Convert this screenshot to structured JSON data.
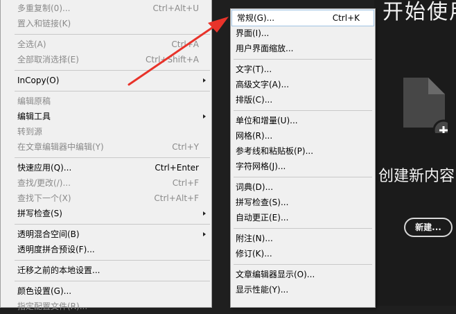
{
  "start": {
    "title": "开始使用",
    "create_text": "创建新内容",
    "new_button": "新建..."
  },
  "left_menu": {
    "items": [
      {
        "label": "多重复制(0)...",
        "shortcut": "Ctrl+Alt+U",
        "disabled": true
      },
      {
        "label": "置入和链接(K)",
        "shortcut": "",
        "disabled": true
      },
      {
        "label": "全选(A)",
        "shortcut": "Ctrl+A",
        "disabled": true
      },
      {
        "label": "全部取消选择(E)",
        "shortcut": "Ctrl+Shift+A",
        "disabled": true
      },
      {
        "label": "InCopy(O)",
        "shortcut": "",
        "disabled": false
      },
      {
        "label": "编辑原稿",
        "shortcut": "",
        "disabled": true
      },
      {
        "label": "编辑工具",
        "shortcut": "",
        "disabled": false
      },
      {
        "label": "转到源",
        "shortcut": "",
        "disabled": true
      },
      {
        "label": "在文章编辑器中编辑(Y)",
        "shortcut": "Ctrl+Y",
        "disabled": true
      },
      {
        "label": "快速应用(Q)...",
        "shortcut": "Ctrl+Enter",
        "disabled": false
      },
      {
        "label": "查找/更改(/)...",
        "shortcut": "Ctrl+F",
        "disabled": true
      },
      {
        "label": "查找下一个(X)",
        "shortcut": "Ctrl+Alt+F",
        "disabled": true
      },
      {
        "label": "拼写检查(S)",
        "shortcut": "",
        "disabled": false
      },
      {
        "label": "透明混合空间(B)",
        "shortcut": "",
        "disabled": false
      },
      {
        "label": "透明度拼合预设(F)...",
        "shortcut": "",
        "disabled": false
      },
      {
        "label": "迁移之前的本地设置...",
        "shortcut": "",
        "disabled": false
      },
      {
        "label": "颜色设置(G)...",
        "shortcut": "",
        "disabled": false
      },
      {
        "label": "指定配置文件(R)...",
        "shortcut": "",
        "disabled": true
      }
    ]
  },
  "sub_menu": {
    "items": [
      {
        "label": "常规(G)...",
        "shortcut": "Ctrl+K"
      },
      {
        "label": "界面(I)...",
        "shortcut": ""
      },
      {
        "label": "用户界面缩放...",
        "shortcut": ""
      },
      {
        "label": "文字(T)...",
        "shortcut": ""
      },
      {
        "label": "高级文字(A)...",
        "shortcut": ""
      },
      {
        "label": "排版(C)...",
        "shortcut": ""
      },
      {
        "label": "单位和增量(U)...",
        "shortcut": ""
      },
      {
        "label": "网格(R)...",
        "shortcut": ""
      },
      {
        "label": "参考线和粘贴板(P)...",
        "shortcut": ""
      },
      {
        "label": "字符网格(J)...",
        "shortcut": ""
      },
      {
        "label": "词典(D)...",
        "shortcut": ""
      },
      {
        "label": "拼写检查(S)...",
        "shortcut": ""
      },
      {
        "label": "自动更正(E)...",
        "shortcut": ""
      },
      {
        "label": "附注(N)...",
        "shortcut": ""
      },
      {
        "label": "修订(K)...",
        "shortcut": ""
      },
      {
        "label": "文章编辑器显示(O)...",
        "shortcut": ""
      },
      {
        "label": "显示性能(Y)...",
        "shortcut": ""
      }
    ]
  },
  "colors": {
    "arrow": "#e8332a",
    "menu_bg": "#f0f0f0",
    "start_bg": "#1b1b1b"
  },
  "icons": [
    "new-file-icon",
    "plus-icon",
    "submenu-arrow-icon",
    "red-arrow-annotation"
  ]
}
